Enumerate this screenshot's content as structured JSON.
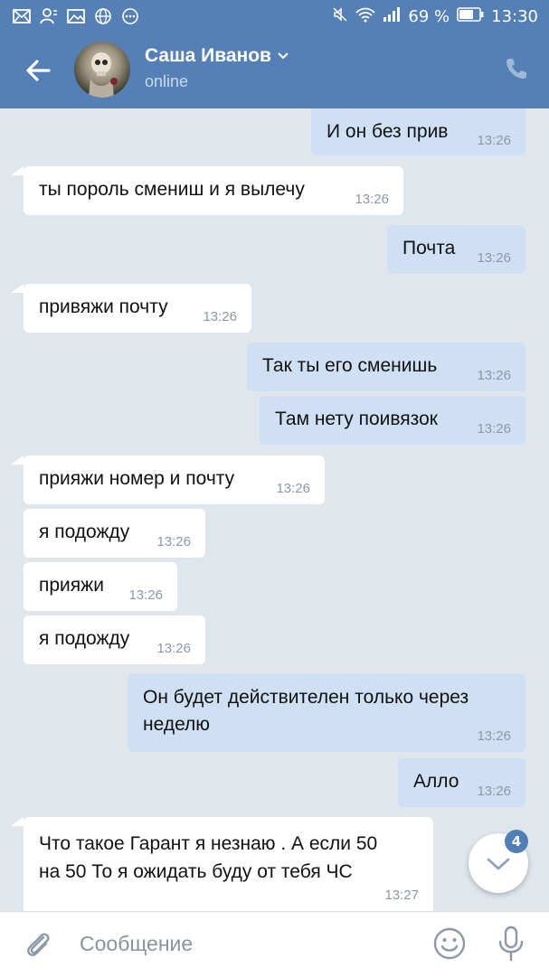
{
  "status_bar": {
    "battery": "69 %",
    "time": "13:30"
  },
  "header": {
    "name": "Саша Иванов",
    "status": "online"
  },
  "messages": [
    {
      "dir": "out",
      "text": "И он без прив",
      "time": "13:26"
    },
    {
      "dir": "in",
      "text": "ты пороль смениш и я вылечу",
      "time": "13:26"
    },
    {
      "dir": "out",
      "text": "Почта",
      "time": "13:26"
    },
    {
      "dir": "in",
      "text": "привяжи почту",
      "time": "13:26"
    },
    {
      "dir": "out",
      "text": "Так ты его сменишь",
      "time": "13:26"
    },
    {
      "dir": "out",
      "text": "Там нету поивязок",
      "time": "13:26"
    },
    {
      "dir": "in",
      "text": "прияжи номер и почту",
      "time": "13:26"
    },
    {
      "dir": "in",
      "text": "я подожду",
      "time": "13:26"
    },
    {
      "dir": "in",
      "text": "прияжи",
      "time": "13:26"
    },
    {
      "dir": "in",
      "text": "я подожду",
      "time": "13:26"
    },
    {
      "dir": "out",
      "text_line1": "Он будет действителен только через",
      "text_line2": "неделю",
      "time": "13:26"
    },
    {
      "dir": "out",
      "text": "Алло",
      "time": "13:26"
    },
    {
      "dir": "in",
      "text_line1": "Что такое Гарант я незнаю . А если 50",
      "text_line2": "на 50 То я ожидать буду от тебя ЧС",
      "time": "13:27"
    }
  ],
  "scroll_button": {
    "unread_count": "4",
    "icon": "chevron-down-icon"
  },
  "composer": {
    "placeholder": "Сообщение"
  },
  "colors": {
    "header": "#5580b5",
    "outgoing_bubble": "#cfe0f4",
    "incoming_bubble": "#ffffff",
    "background": "#dfe6ec"
  }
}
